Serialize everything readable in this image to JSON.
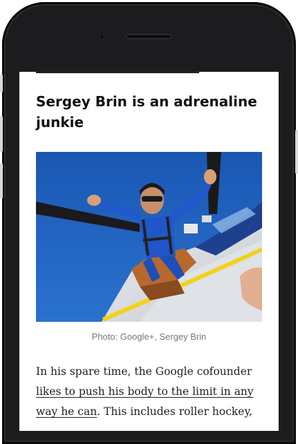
{
  "article": {
    "headline": "Sergey Brin is an adrenaline junkie",
    "photo_caption": "Photo: Google+, Sergey Brin",
    "body_before_link": "In his spare time, the Google cofounder ",
    "body_link": "likes to push his body to the limit in any way he can",
    "body_after_link": ". This includes roller hockey,"
  },
  "colors": {
    "phone_frame": "#1c1c1e",
    "sky": "#1e5fb8",
    "jumpsuit": "#1f55c9",
    "text": "#111111"
  }
}
